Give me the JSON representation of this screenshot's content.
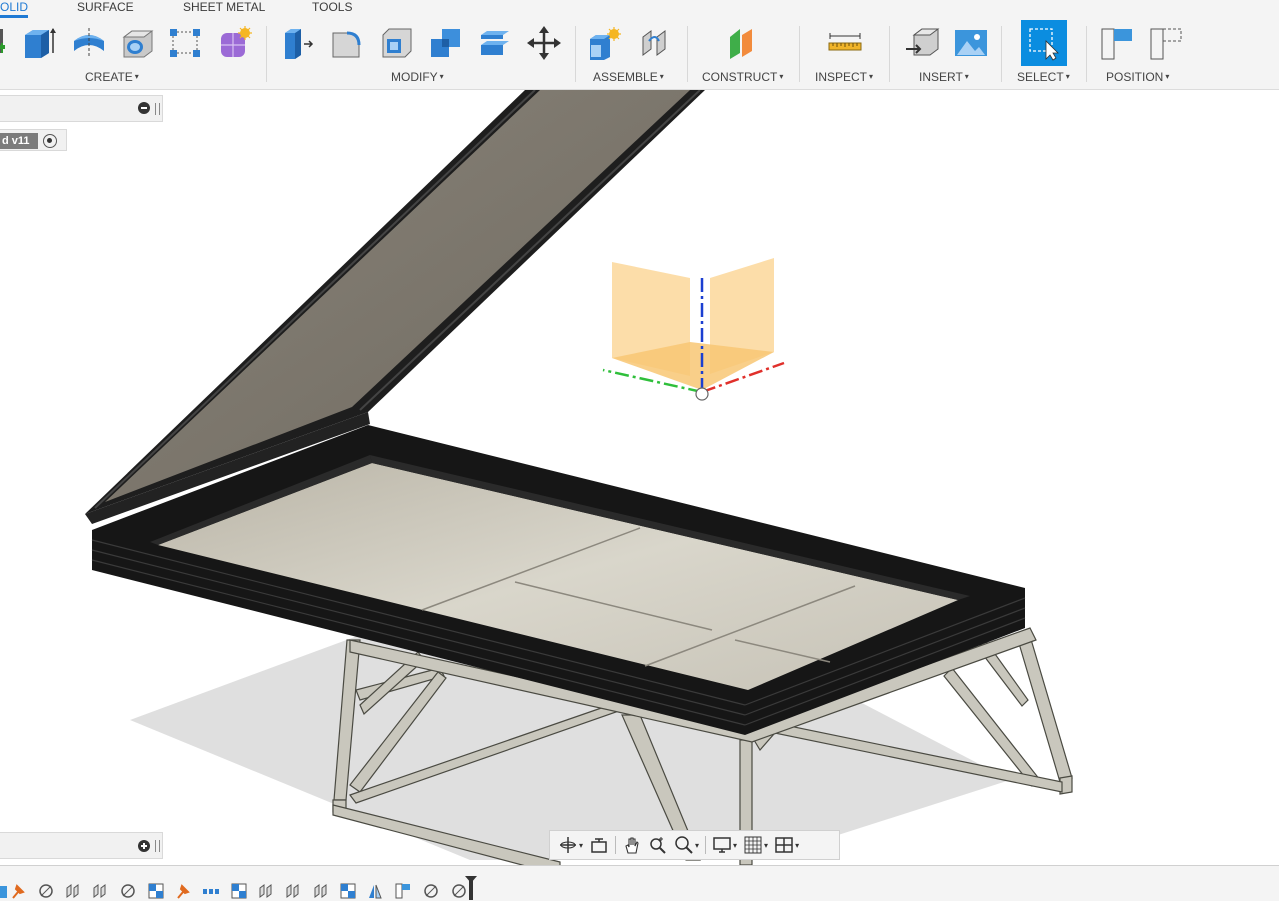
{
  "tabs": [
    {
      "label": "OLID",
      "active": true
    },
    {
      "label": "SURFACE",
      "active": false
    },
    {
      "label": "SHEET METAL",
      "active": false
    },
    {
      "label": "TOOLS",
      "active": false
    }
  ],
  "groups": {
    "create": "CREATE",
    "modify": "MODIFY",
    "assemble": "ASSEMBLE",
    "construct": "CONSTRUCT",
    "inspect": "INSPECT",
    "insert": "INSERT",
    "select": "SELECT",
    "position": "POSITION"
  },
  "caret": "▾",
  "browser": {
    "document_label": "d v11"
  },
  "toolbar_icons": {
    "create": [
      "new-component-icon",
      "extrude-icon",
      "revolve-icon",
      "hole-icon",
      "pattern-icon",
      "create-form-icon"
    ],
    "modify": [
      "press-pull-icon",
      "fillet-icon",
      "shell-icon",
      "combine-icon",
      "split-body-icon",
      "move-copy-icon"
    ],
    "assemble": [
      "new-component-icon",
      "joint-icon"
    ],
    "construct": [
      "offset-plane-icon"
    ],
    "inspect": [
      "measure-icon"
    ],
    "insert": [
      "insert-derive-icon",
      "insert-image-icon"
    ],
    "select": [
      "select-icon"
    ],
    "position": [
      "capture-position-icon",
      "revert-position-icon"
    ]
  },
  "nav_icons": [
    "orbit-icon",
    "look-at-icon",
    "pan-icon",
    "zoom-icon",
    "zoom-window-icon",
    "display-settings-icon",
    "grid-icon",
    "viewports-icon"
  ],
  "colors": {
    "accent": "#1f7ad4",
    "select_active": "#0b8de0"
  }
}
